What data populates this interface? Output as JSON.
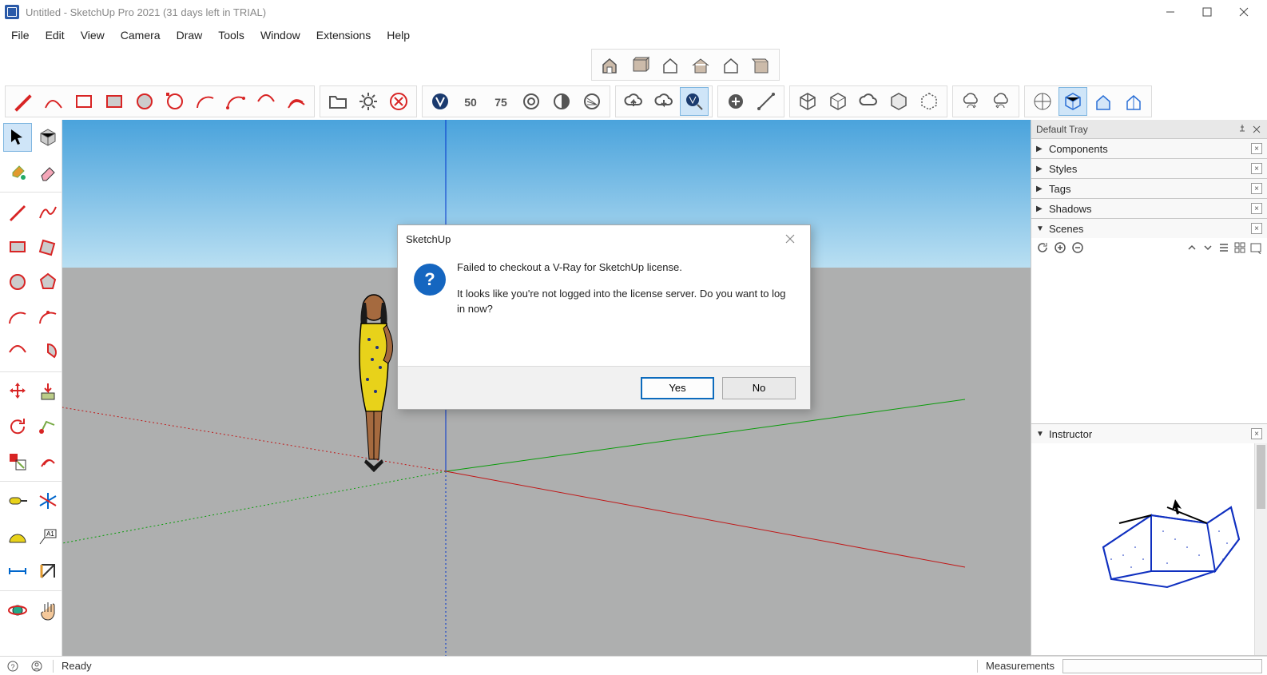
{
  "window": {
    "title": "Untitled - SketchUp Pro 2021 (31 days left in TRIAL)"
  },
  "menu": [
    "File",
    "Edit",
    "View",
    "Camera",
    "Draw",
    "Tools",
    "Window",
    "Extensions",
    "Help"
  ],
  "top_toolbar_row1_icons": [
    "house-open",
    "box",
    "house-frame",
    "house-roof",
    "house-outline",
    "box-open"
  ],
  "top_toolbar_row2_groups": [
    {
      "icons": [
        "pencil-draw",
        "curve-draw",
        "rect-draw",
        "rect-fill",
        "circle",
        "circle-select",
        "arc",
        "arc-2pt",
        "arc-free",
        "offset-arc"
      ]
    },
    {
      "icons": [
        "folder",
        "gear",
        "close-circle"
      ]
    },
    {
      "icons": [
        "vray-logo",
        "vray-50",
        "vray-75",
        "render-circle",
        "render-half",
        "render-hatch"
      ]
    },
    {
      "icons": [
        "cloud-up",
        "cloud-down",
        "vray-cursor"
      ],
      "active": 2
    },
    {
      "icons": [
        "plus-circle",
        "line-tool"
      ]
    },
    {
      "icons": [
        "cube-1",
        "cube-2",
        "cloud",
        "cube-3",
        "cube-4"
      ]
    },
    {
      "icons": [
        "cloud-sync-up",
        "cloud-sync-down"
      ]
    },
    {
      "icons": [
        "iso-view",
        "cube-blue",
        "house-blue-1",
        "house-blue-2"
      ],
      "active": 1
    }
  ],
  "left_tools": [
    [
      "select-arrow",
      "component-cube"
    ],
    [
      "paint-bucket",
      "eraser"
    ],
    null,
    [
      "pencil",
      "freehand"
    ],
    [
      "rectangle",
      "rotated-rect"
    ],
    [
      "circle-tool",
      "polygon"
    ],
    [
      "arc-tool-1",
      "arc-tool-2"
    ],
    [
      "arc-tool-3",
      "pie"
    ],
    null,
    [
      "move",
      "pushpull"
    ],
    [
      "rotate",
      "followme"
    ],
    [
      "scale",
      "offset"
    ],
    null,
    [
      "tape",
      "axes-tool"
    ],
    [
      "protractor",
      "text-label"
    ],
    [
      "dimension",
      "section"
    ],
    null,
    [
      "orbit",
      "pan"
    ]
  ],
  "tray": {
    "title": "Default Tray",
    "panels": [
      {
        "label": "Components",
        "collapsed": true
      },
      {
        "label": "Styles",
        "collapsed": true
      },
      {
        "label": "Tags",
        "collapsed": true
      },
      {
        "label": "Shadows",
        "collapsed": true
      },
      {
        "label": "Scenes",
        "collapsed": false
      },
      {
        "label": "Instructor",
        "collapsed": false
      }
    ]
  },
  "dialog": {
    "title": "SketchUp",
    "line1": "Failed to checkout a V-Ray for SketchUp license.",
    "line2": "It looks like you're not logged into the license server. Do you want to log in now?",
    "yes": "Yes",
    "no": "No"
  },
  "status": {
    "ready": "Ready",
    "measurements_label": "Measurements"
  }
}
